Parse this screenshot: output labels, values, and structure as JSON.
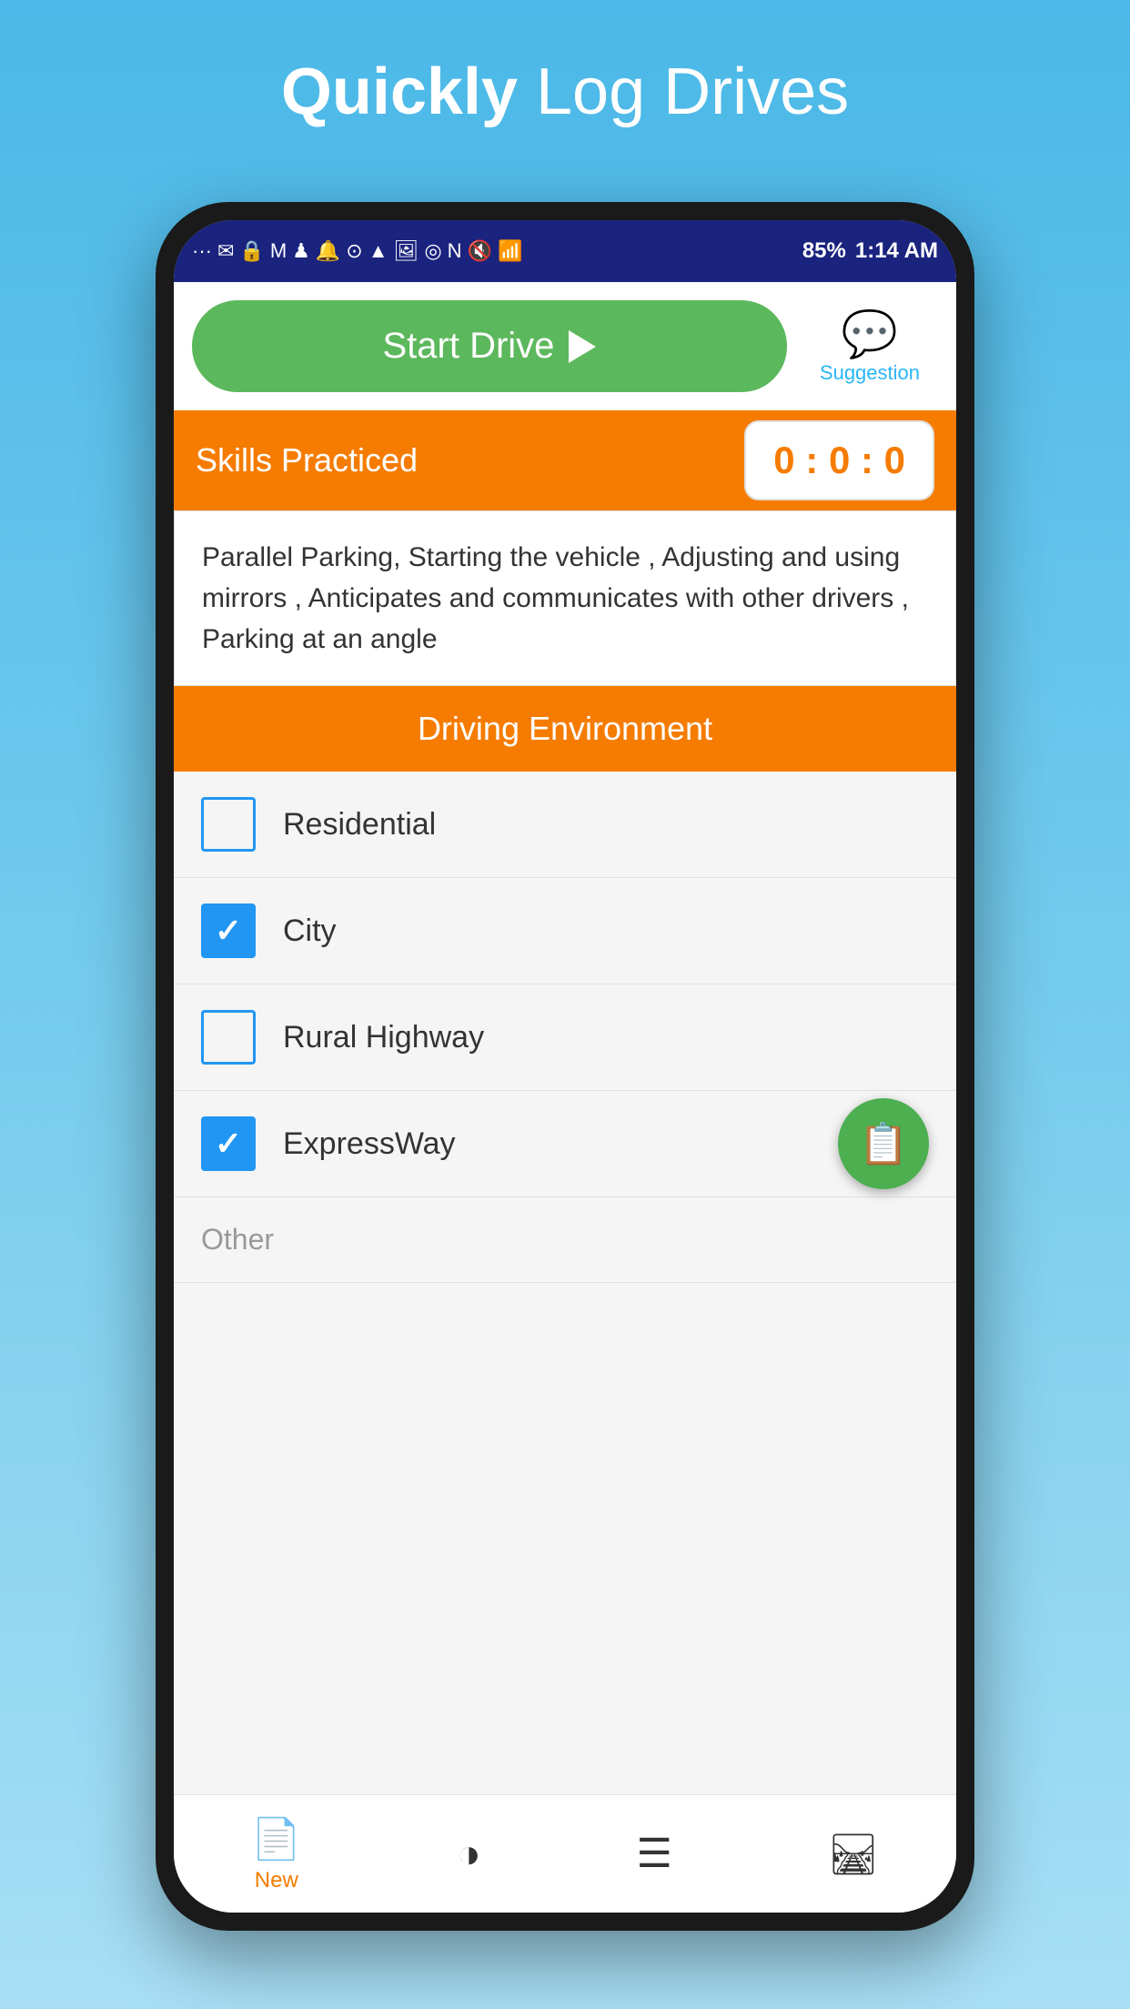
{
  "page": {
    "title_bold": "Quickly",
    "title_light": " Log Drives"
  },
  "status_bar": {
    "time": "1:14 AM",
    "battery": "85%",
    "icons": "··· ✉ 🔒 M ♟ 🔔 ⊙ ▲ 🖼 ◎ N 🔇 WiFi ▶ 📶"
  },
  "app": {
    "start_drive_label": "Start Drive",
    "suggestion_label": "Suggestion",
    "skills_label": "Skills Practiced",
    "timer": "0 : 0 : 0",
    "skills_text": "Parallel Parking, Starting the vehicle , Adjusting and using mirrors , Anticipates and communicates with other drivers , Parking at an angle",
    "driving_env_label": "Driving Environment",
    "checkboxes": [
      {
        "label": "Residential",
        "checked": false
      },
      {
        "label": "City",
        "checked": true
      },
      {
        "label": "Rural Highway",
        "checked": false
      },
      {
        "label": "ExpressWay",
        "checked": true
      }
    ],
    "other_label": "Other"
  },
  "bottom_nav": [
    {
      "label": "New",
      "icon": "📄",
      "active": true
    },
    {
      "label": "",
      "icon": "◑",
      "active": false
    },
    {
      "label": "",
      "icon": "☰",
      "active": false
    },
    {
      "label": "",
      "icon": "🛤",
      "active": false
    }
  ]
}
